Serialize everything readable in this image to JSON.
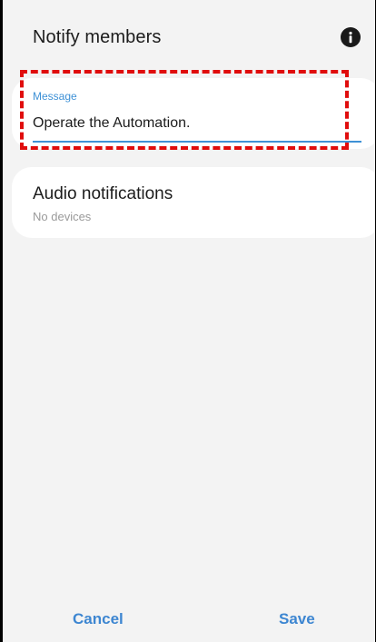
{
  "header": {
    "title": "Notify members",
    "info_icon": "info-icon"
  },
  "message": {
    "label": "Message",
    "value": "Operate the Automation.",
    "accent_color": "#3e91d6",
    "highlight_color": "#e00d0d"
  },
  "audio": {
    "title": "Audio notifications",
    "subtitle": "No devices"
  },
  "footer": {
    "cancel_label": "Cancel",
    "save_label": "Save",
    "button_color": "#3d86d1"
  }
}
